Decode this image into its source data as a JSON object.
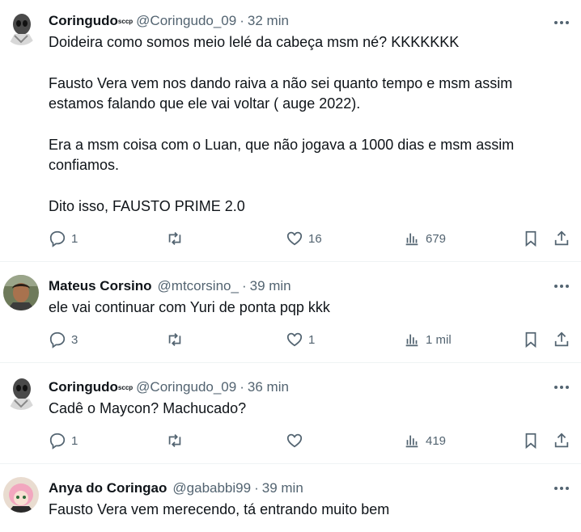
{
  "tweets": [
    {
      "name": "Coringudo",
      "badge": "sccp",
      "handle": "@Coringudo_09",
      "sep": "·",
      "time": "32 min",
      "lines": [
        "Doideira como somos meio lelé da cabeça msm né? KKKKKKK",
        "",
        "Fausto Vera vem nos dando raiva a não sei quanto tempo e msm assim",
        "estamos falando que ele vai voltar ( auge 2022).",
        "",
        "Era a msm coisa com o Luan, que não jogava a 1000 dias e msm assim",
        "confiamos.",
        "",
        "Dito isso, FAUSTO PRIME 2.0"
      ],
      "replies": "1",
      "retweets": "",
      "likes": "16",
      "views": "679"
    },
    {
      "name": "Mateus Corsino",
      "badge": "",
      "handle": "@mtcorsino_",
      "sep": "·",
      "time": "39 min",
      "lines": [
        "ele vai continuar com Yuri de ponta pqp kkk"
      ],
      "replies": "3",
      "retweets": "",
      "likes": "1",
      "views": "1 mil"
    },
    {
      "name": "Coringudo",
      "badge": "sccp",
      "handle": "@Coringudo_09",
      "sep": "·",
      "time": "36 min",
      "lines": [
        "Cadê o Maycon? Machucado?"
      ],
      "replies": "1",
      "retweets": "",
      "likes": "",
      "views": "419"
    },
    {
      "name": "Anya do Coringao",
      "badge": "",
      "handle": "@gababbi99",
      "sep": "·",
      "time": "39 min",
      "lines": [
        "Fausto Vera vem merecendo, tá entrando muito bem"
      ],
      "replies": "",
      "retweets": "",
      "likes": "",
      "views": ""
    }
  ],
  "icons": {
    "more": "more-icon",
    "reply": "reply-icon",
    "retweet": "retweet-icon",
    "like": "heart-icon",
    "views": "views-icon",
    "bookmark": "bookmark-icon",
    "share": "share-icon"
  },
  "colors": {
    "text": "#0f1419",
    "secondary": "#536471",
    "divider": "#eff3f4"
  }
}
